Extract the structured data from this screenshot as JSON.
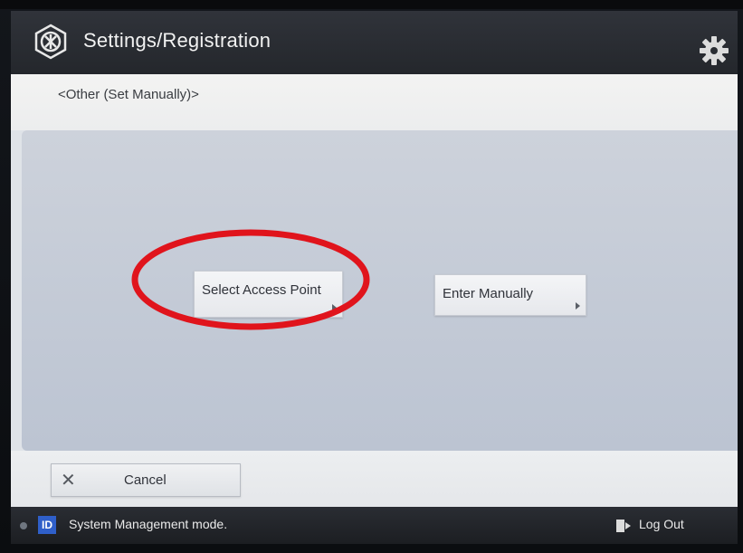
{
  "header": {
    "title": "Settings/Registration",
    "app_icon": "settings-registration-icon",
    "settings_icon": "gear-icon"
  },
  "breadcrumb": "<Other (Set Manually)>",
  "options": [
    {
      "label": "Select Access Point",
      "icon": "chevron-right-icon"
    },
    {
      "label": "Enter Manually",
      "icon": "chevron-right-icon"
    }
  ],
  "highlight": {
    "color": "#e0141c",
    "target": "Select Access Point"
  },
  "cancel": {
    "label": "Cancel",
    "icon": "close-icon"
  },
  "status_bar": {
    "id_label": "ID",
    "mode_text": "System Management mode.",
    "logout_label": "Log Out",
    "logout_icon": "logout-icon"
  },
  "colors": {
    "header_bg": "#2a2d33",
    "panel_bg": "#c5ccd8",
    "id_badge": "#2f5fc9",
    "annotation": "#e0141c"
  }
}
